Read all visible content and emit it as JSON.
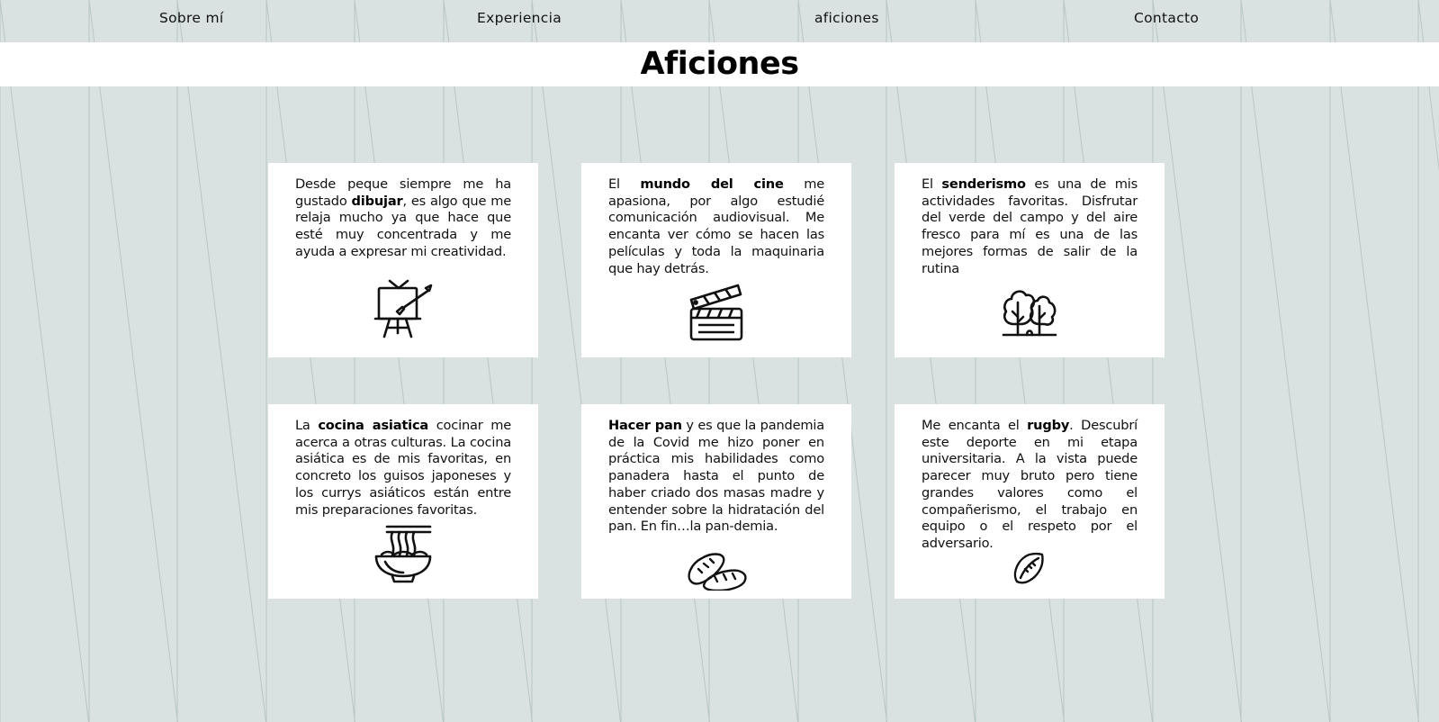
{
  "nav": {
    "items": [
      {
        "label": "Sobre mí"
      },
      {
        "label": "Experiencia"
      },
      {
        "label": "aficiones"
      },
      {
        "label": "Contacto"
      }
    ]
  },
  "page": {
    "title": "Aficiones"
  },
  "cards": [
    {
      "text_before": "Desde peque siempre me ha gustado ",
      "bold": "dibujar",
      "text_after": ", es algo que me relaja mucho ya que hace que esté muy concentrada y me ayuda a expresar mi creatividad.",
      "icon": "easel-painting-icon"
    },
    {
      "text_before": "El ",
      "bold": "mundo del cine",
      "text_after": " me apasiona, por algo estudié comunicación audiovisual. Me encanta ver cómo se hacen las películas y toda la maquinaria que hay detrás.",
      "icon": "clapperboard-icon"
    },
    {
      "text_before": "El ",
      "bold": "senderismo",
      "text_after": " es una de mis actividades favoritas. Disfrutar del verde del campo y del aire fresco para mí es una de las mejores formas de salir de la rutina",
      "icon": "trees-icon"
    },
    {
      "text_before": "La ",
      "bold": "cocina asiatica",
      "text_after": " cocinar me acerca a otras culturas. La cocina asiática es de mis favoritas, en concreto los guisos japoneses y los currys asiáticos están entre mis preparaciones favoritas.",
      "icon": "noodle-bowl-icon"
    },
    {
      "text_before": "",
      "bold": "Hacer pan",
      "text_after": " y es que la pandemia de la Covid me hizo poner en práctica mis habilidades como panadera hasta el punto de haber criado dos masas madre y entender sobre la hidratación del pan. En fin…la pan-demia.",
      "icon": "bread-icon"
    },
    {
      "text_before": "Me encanta el ",
      "bold": "rugby",
      "text_after": ". Descubrí este deporte en mi etapa universitaria. A la vista puede parecer muy bruto pero tiene grandes valores como el compañerismo, el trabajo en equipo o el respeto por el adversario.",
      "icon": "rugby-ball-icon"
    }
  ],
  "colors": {
    "background": "#d9e2e1",
    "pattern_line": "#b8c6c4",
    "card": "#ffffff",
    "text": "#111111"
  }
}
